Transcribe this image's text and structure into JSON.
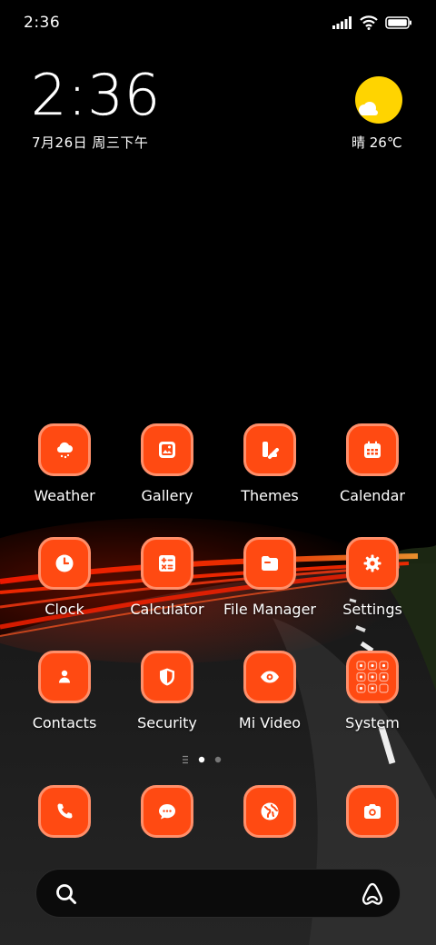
{
  "status_bar": {
    "time": "2:36",
    "icons": [
      "signal-icon",
      "wifi-icon",
      "battery-icon"
    ]
  },
  "clock_widget": {
    "time": "2:36",
    "date": "7月26日 周三下午"
  },
  "weather_widget": {
    "text": "晴 26℃",
    "icon": "sunny-partly-cloudy-icon"
  },
  "apps": [
    {
      "label": "Weather",
      "icon": "weather-icon"
    },
    {
      "label": "Gallery",
      "icon": "gallery-icon"
    },
    {
      "label": "Themes",
      "icon": "themes-icon"
    },
    {
      "label": "Calendar",
      "icon": "calendar-icon"
    },
    {
      "label": "Clock",
      "icon": "clock-icon"
    },
    {
      "label": "Calculator",
      "icon": "calculator-icon"
    },
    {
      "label": "File Manager",
      "icon": "folder-icon"
    },
    {
      "label": "Settings",
      "icon": "gear-icon"
    },
    {
      "label": "Contacts",
      "icon": "contacts-icon"
    },
    {
      "label": "Security",
      "icon": "shield-icon"
    },
    {
      "label": "Mi Video",
      "icon": "eye-icon"
    },
    {
      "label": "System",
      "icon": "folder-grid-icon"
    }
  ],
  "page_indicator": {
    "pages": 2,
    "current": 1
  },
  "dock": [
    {
      "icon": "phone-icon"
    },
    {
      "icon": "messages-icon"
    },
    {
      "icon": "browser-icon"
    },
    {
      "icon": "camera-icon"
    }
  ],
  "search_bar": {
    "search_icon": "search-icon",
    "assistant_icon": "assistant-icon"
  },
  "colors": {
    "icon_fill": "#ff4a12",
    "icon_border": "#ff8f6a",
    "sun": "#ffd400"
  }
}
